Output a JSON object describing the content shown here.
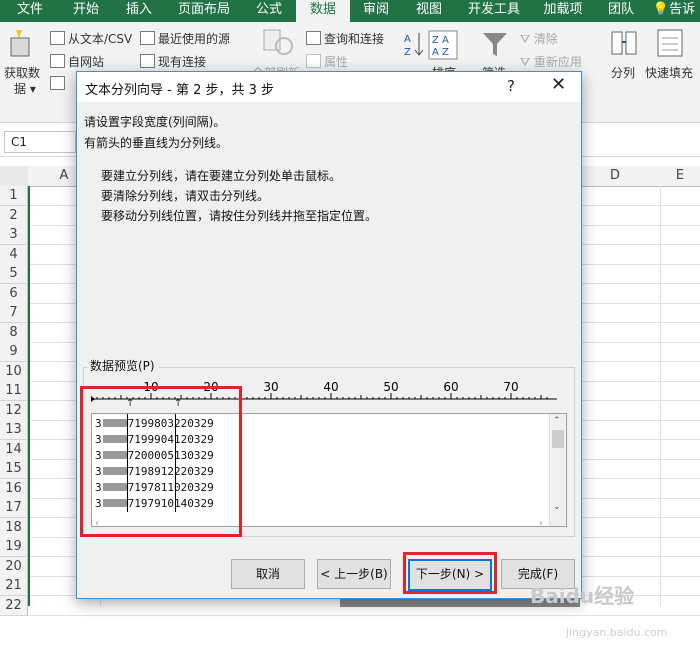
{
  "ribbon_tabs": [
    "文件",
    "开始",
    "插入",
    "页面布局",
    "公式",
    "数据",
    "审阅",
    "视图",
    "开发工具",
    "加载项",
    "团队",
    "告诉"
  ],
  "ribbon": {
    "get_data": "获取数",
    "get_data2": "据",
    "from_text_csv": "从文本/CSV",
    "recent_sources": "最近使用的源",
    "from_web": "自网站",
    "existing_connections": "现有连接",
    "refresh_all": "全部刷新",
    "queries_connections": "查询和连接",
    "properties": "属性",
    "sort": "排序",
    "filter": "筛选",
    "clear": "清除",
    "reapply": "重新应用",
    "text_to_columns": "分列",
    "flash_fill": "快速填充"
  },
  "formula_bar": {
    "name_box": "C1"
  },
  "grid": {
    "columns": [
      "A",
      "D",
      "E"
    ],
    "rows": [
      "1",
      "2",
      "3",
      "4",
      "5",
      "6",
      "7",
      "8",
      "9",
      "10",
      "11",
      "12",
      "13",
      "14",
      "15",
      "16",
      "17",
      "18",
      "19",
      "20",
      "21",
      "22"
    ]
  },
  "dialog": {
    "title": "文本分列向导 - 第 2 步，共 3 步",
    "help": "?",
    "close": "✕",
    "intro1": "请设置字段宽度(列间隔)。",
    "intro2": "有箭头的垂直线为分列线。",
    "tip1": "要建立分列线，请在要建立分列处单击鼠标。",
    "tip2": "要清除分列线，请双击分列线。",
    "tip3": "要移动分列线位置，请按住分列线并拖至指定位置。",
    "preview_label": "数据预览(P)",
    "ruler_ticks": [
      "10",
      "20",
      "30",
      "40",
      "50",
      "60",
      "70"
    ],
    "preview_rows": [
      {
        "prefix": "3",
        "value": "7199803220329"
      },
      {
        "prefix": "3",
        "value": "7199904120329"
      },
      {
        "prefix": "3",
        "value": "7200005130329"
      },
      {
        "prefix": "3",
        "value": "7198912220329"
      },
      {
        "prefix": "3",
        "value": "7197811020329"
      },
      {
        "prefix": "3",
        "value": "7197910140329"
      }
    ],
    "buttons": {
      "cancel": "取消",
      "back": "< 上一步(B)",
      "next": "下一步(N) >",
      "finish": "完成(F)"
    }
  },
  "watermark": {
    "brand": "Baidu经验",
    "url": "jingyan.baidu.com"
  },
  "colors": {
    "excel_green": "#217346",
    "highlight_red": "#e0242c",
    "focus_blue": "#0078d7"
  }
}
